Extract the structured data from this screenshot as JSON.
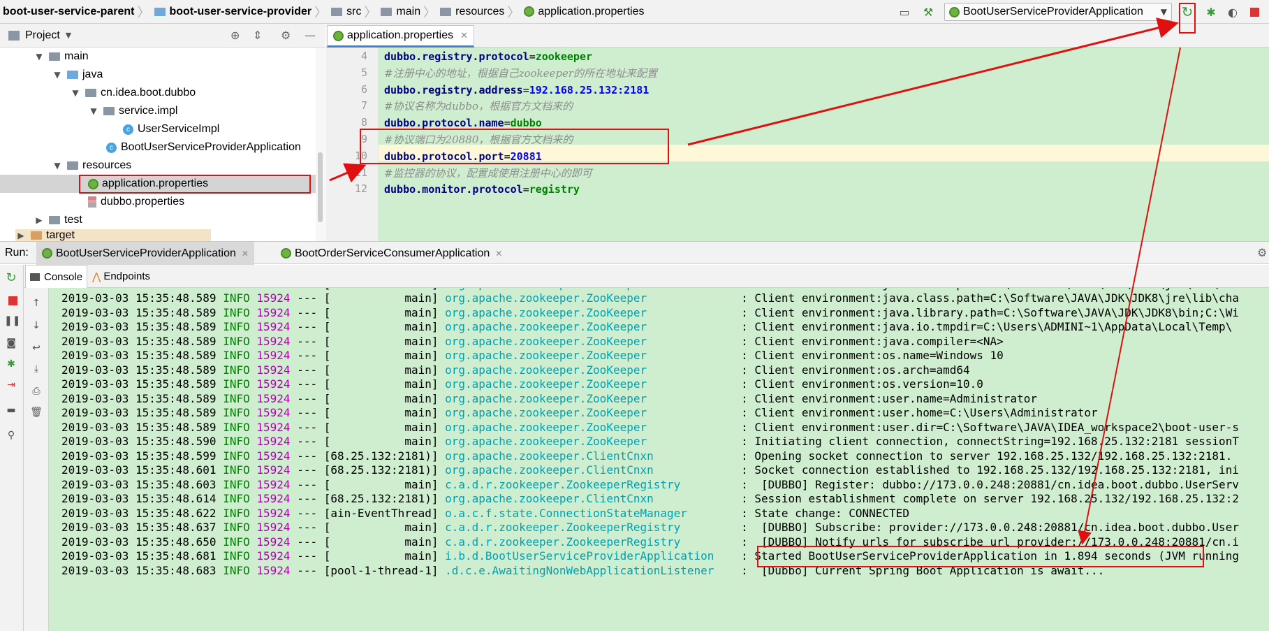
{
  "breadcrumb": {
    "items": [
      {
        "label": "boot-user-service-parent",
        "bold": true
      },
      {
        "label": "boot-user-service-provider",
        "bold": true
      },
      {
        "label": "src",
        "bold": false
      },
      {
        "label": "main",
        "bold": false
      },
      {
        "label": "resources",
        "bold": false
      },
      {
        "label": "application.properties",
        "bold": false
      }
    ]
  },
  "toolbar": {
    "run_config": "BootUserServiceProviderApplication"
  },
  "project_panel": {
    "title": "Project",
    "tree": [
      {
        "label": "main"
      },
      {
        "label": "java"
      },
      {
        "label": "cn.idea.boot.dubbo"
      },
      {
        "label": "service.impl"
      },
      {
        "label": "UserServiceImpl"
      },
      {
        "label": "BootUserServiceProviderApplication"
      },
      {
        "label": "resources"
      },
      {
        "label": "application.properties"
      },
      {
        "label": "dubbo.properties"
      },
      {
        "label": "test"
      },
      {
        "label": "target"
      }
    ]
  },
  "editor": {
    "tab_label": "application.properties",
    "lines": [
      {
        "num": "4",
        "key": "dubbo.registry.protocol",
        "eq": "=",
        "value": "zookeeper",
        "comment": ""
      },
      {
        "num": "5",
        "key": "",
        "eq": "",
        "value": "",
        "comment": "#注册中心的地址，根据自己zookeeper的所在地址来配置"
      },
      {
        "num": "6",
        "key": "dubbo.registry.address",
        "eq": "=",
        "value": "192.168.25.132:2181",
        "comment": ""
      },
      {
        "num": "7",
        "key": "",
        "eq": "",
        "value": "",
        "comment": "#协议名称为dubbo，根据官方文档来的"
      },
      {
        "num": "8",
        "key": "dubbo.protocol.name",
        "eq": "=",
        "value": "dubbo",
        "comment": ""
      },
      {
        "num": "9",
        "key": "",
        "eq": "",
        "value": "",
        "comment": "#协议端口为20880，根据官方文档来的"
      },
      {
        "num": "10",
        "key": "dubbo.protocol.port",
        "eq": "=",
        "value": "20881",
        "comment": ""
      },
      {
        "num": "11",
        "key": "",
        "eq": "",
        "value": "",
        "comment": "#监控器的协议，配置成使用注册中心的即可"
      },
      {
        "num": "12",
        "key": "dubbo.monitor.protocol",
        "eq": "=",
        "value": "registry",
        "comment": ""
      }
    ]
  },
  "run_panel": {
    "label": "Run:",
    "tabs": [
      "BootUserServiceProviderApplication",
      "BootOrderServiceConsumerApplication"
    ],
    "subtabs": [
      "Console",
      "Endpoints"
    ]
  },
  "console": {
    "rows": [
      {
        "ts": "2019-03-03 15:35:48.589",
        "lv": "INFO",
        "pid": "15924",
        "th": "--- [           main]",
        "lg": "org.apache.zookeeper.ZooKeeper",
        "msg": ": Client environment:java.class.path=C:\\Software\\JAVA\\JDK\\JDK8\\jre\\lib\\cha"
      },
      {
        "ts": "2019-03-03 15:35:48.589",
        "lv": "INFO",
        "pid": "15924",
        "th": "--- [           main]",
        "lg": "org.apache.zookeeper.ZooKeeper",
        "msg": ": Client environment:java.library.path=C:\\Software\\JAVA\\JDK\\JDK8\\bin;C:\\Wi"
      },
      {
        "ts": "2019-03-03 15:35:48.589",
        "lv": "INFO",
        "pid": "15924",
        "th": "--- [           main]",
        "lg": "org.apache.zookeeper.ZooKeeper",
        "msg": ": Client environment:java.io.tmpdir=C:\\Users\\ADMINI~1\\AppData\\Local\\Temp\\"
      },
      {
        "ts": "2019-03-03 15:35:48.589",
        "lv": "INFO",
        "pid": "15924",
        "th": "--- [           main]",
        "lg": "org.apache.zookeeper.ZooKeeper",
        "msg": ": Client environment:java.compiler=<NA>"
      },
      {
        "ts": "2019-03-03 15:35:48.589",
        "lv": "INFO",
        "pid": "15924",
        "th": "--- [           main]",
        "lg": "org.apache.zookeeper.ZooKeeper",
        "msg": ": Client environment:os.name=Windows 10"
      },
      {
        "ts": "2019-03-03 15:35:48.589",
        "lv": "INFO",
        "pid": "15924",
        "th": "--- [           main]",
        "lg": "org.apache.zookeeper.ZooKeeper",
        "msg": ": Client environment:os.arch=amd64"
      },
      {
        "ts": "2019-03-03 15:35:48.589",
        "lv": "INFO",
        "pid": "15924",
        "th": "--- [           main]",
        "lg": "org.apache.zookeeper.ZooKeeper",
        "msg": ": Client environment:os.version=10.0"
      },
      {
        "ts": "2019-03-03 15:35:48.589",
        "lv": "INFO",
        "pid": "15924",
        "th": "--- [           main]",
        "lg": "org.apache.zookeeper.ZooKeeper",
        "msg": ": Client environment:user.name=Administrator"
      },
      {
        "ts": "2019-03-03 15:35:48.589",
        "lv": "INFO",
        "pid": "15924",
        "th": "--- [           main]",
        "lg": "org.apache.zookeeper.ZooKeeper",
        "msg": ": Client environment:user.home=C:\\Users\\Administrator"
      },
      {
        "ts": "2019-03-03 15:35:48.589",
        "lv": "INFO",
        "pid": "15924",
        "th": "--- [           main]",
        "lg": "org.apache.zookeeper.ZooKeeper",
        "msg": ": Client environment:user.dir=C:\\Software\\JAVA\\IDEA_workspace2\\boot-user-s"
      },
      {
        "ts": "2019-03-03 15:35:48.590",
        "lv": "INFO",
        "pid": "15924",
        "th": "--- [           main]",
        "lg": "org.apache.zookeeper.ZooKeeper",
        "msg": ": Initiating client connection, connectString=192.168.25.132:2181 sessionT"
      },
      {
        "ts": "2019-03-03 15:35:48.599",
        "lv": "INFO",
        "pid": "15924",
        "th": "--- [68.25.132:2181)]",
        "lg": "org.apache.zookeeper.ClientCnxn",
        "msg": ": Opening socket connection to server 192.168.25.132/192.168.25.132:2181. "
      },
      {
        "ts": "2019-03-03 15:35:48.601",
        "lv": "INFO",
        "pid": "15924",
        "th": "--- [68.25.132:2181)]",
        "lg": "org.apache.zookeeper.ClientCnxn",
        "msg": ": Socket connection established to 192.168.25.132/192.168.25.132:2181, ini"
      },
      {
        "ts": "2019-03-03 15:35:48.603",
        "lv": "INFO",
        "pid": "15924",
        "th": "--- [           main]",
        "lg": "c.a.d.r.zookeeper.ZookeeperRegistry",
        "msg": ":  [DUBBO] Register: dubbo://173.0.0.248:20881/cn.idea.boot.dubbo.UserServ"
      },
      {
        "ts": "2019-03-03 15:35:48.614",
        "lv": "INFO",
        "pid": "15924",
        "th": "--- [68.25.132:2181)]",
        "lg": "org.apache.zookeeper.ClientCnxn",
        "msg": ": Session establishment complete on server 192.168.25.132/192.168.25.132:2"
      },
      {
        "ts": "2019-03-03 15:35:48.622",
        "lv": "INFO",
        "pid": "15924",
        "th": "--- [ain-EventThread]",
        "lg": "o.a.c.f.state.ConnectionStateManager",
        "msg": ": State change: CONNECTED"
      },
      {
        "ts": "2019-03-03 15:35:48.637",
        "lv": "INFO",
        "pid": "15924",
        "th": "--- [           main]",
        "lg": "c.a.d.r.zookeeper.ZookeeperRegistry",
        "msg": ":  [DUBBO] Subscribe: provider://173.0.0.248:20881/cn.idea.boot.dubbo.User"
      },
      {
        "ts": "2019-03-03 15:35:48.650",
        "lv": "INFO",
        "pid": "15924",
        "th": "--- [           main]",
        "lg": "c.a.d.r.zookeeper.ZookeeperRegistry",
        "msg": ":  [DUBBO] Notify urls for subscribe url provider://173.0.0.248:20881/cn.i"
      },
      {
        "ts": "2019-03-03 15:35:48.681",
        "lv": "INFO",
        "pid": "15924",
        "th": "--- [           main]",
        "lg": "i.b.d.BootUserServiceProviderApplication",
        "msg": ": Started BootUserServiceProviderApplication in 1.894 seconds (JVM running"
      },
      {
        "ts": "2019-03-03 15:35:48.683",
        "lv": "INFO",
        "pid": "15924",
        "th": "--- [pool-1-thread-1]",
        "lg": ".d.c.e.AwaitingNonWebApplicationListener",
        "msg": ":  [Dubbo] Current Spring Boot Application is await..."
      }
    ],
    "partial_top": {
      "ts": "2019-03-03 15:35:48.589",
      "lv": "INFO",
      "pid": "15924",
      "th": "--- [           main]",
      "lg": "org.apache.zookeeper.ZooKeeper",
      "msg": ": Client environment:java.class.path=C:\\Software\\JAVA\\JDK\\JDK8\\jre\\lib\\cha"
    }
  },
  "colors": {
    "highlight_red": "#e01010",
    "editor_bg": "#cfeecf",
    "accent_blue": "#4083c9"
  }
}
